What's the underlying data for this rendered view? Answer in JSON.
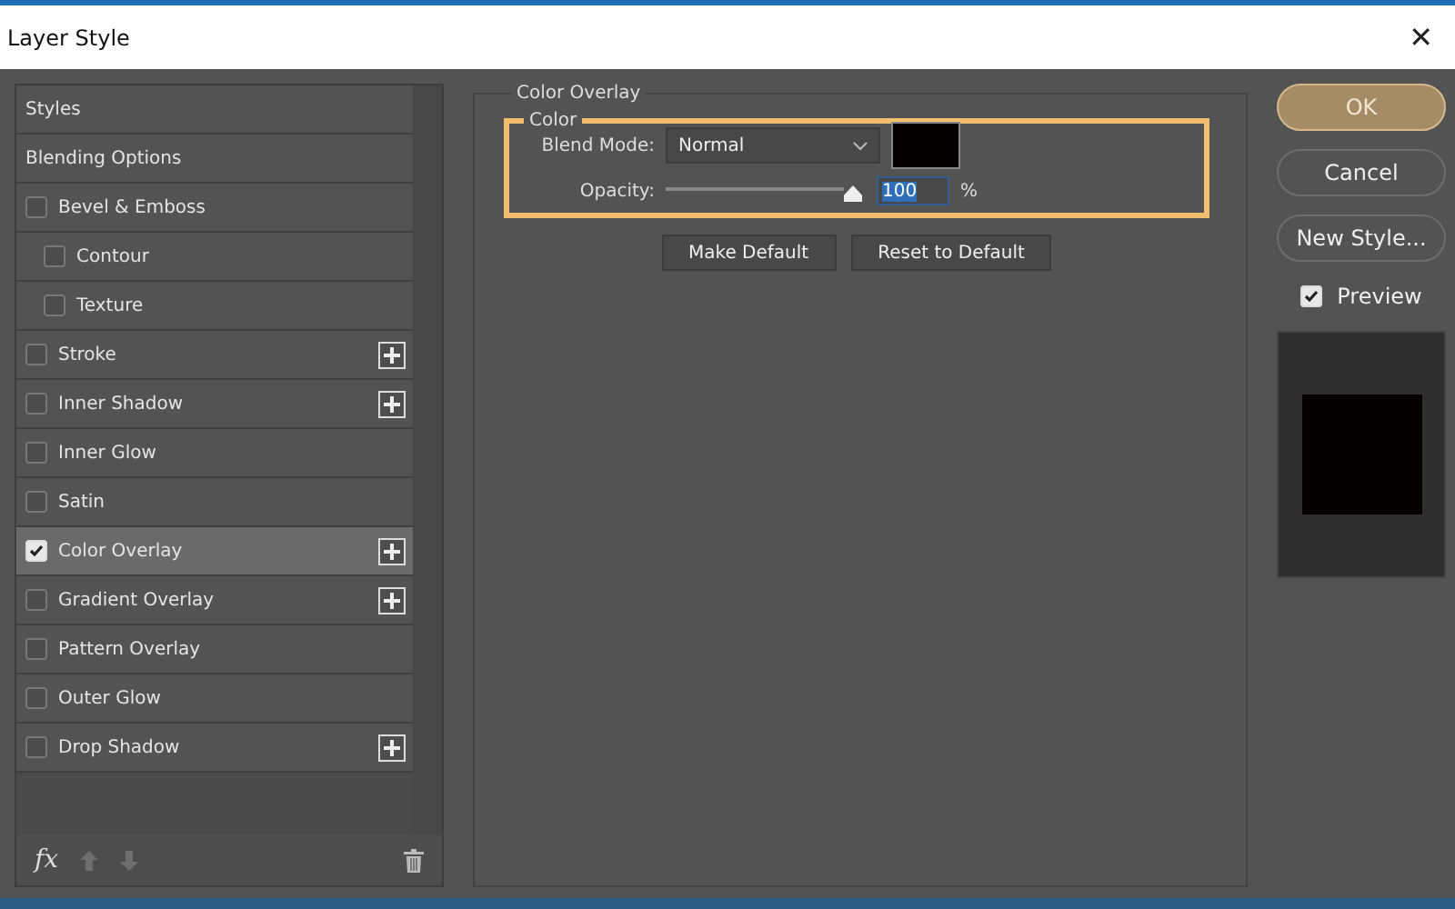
{
  "window": {
    "title": "Layer Style",
    "close": "✕"
  },
  "styles_list": [
    {
      "label": "Styles",
      "kind": "header",
      "selected": false
    },
    {
      "label": "Blending Options",
      "kind": "header",
      "selected": false
    },
    {
      "label": "Bevel & Emboss",
      "kind": "effect",
      "checked": false,
      "selected": false,
      "add": false,
      "children": [
        {
          "label": "Contour",
          "kind": "effect",
          "checked": false,
          "selected": false,
          "add": false
        },
        {
          "label": "Texture",
          "kind": "effect",
          "checked": false,
          "selected": false,
          "add": false
        }
      ]
    },
    {
      "label": "Stroke",
      "kind": "effect",
      "checked": false,
      "selected": false,
      "add": true
    },
    {
      "label": "Inner Shadow",
      "kind": "effect",
      "checked": false,
      "selected": false,
      "add": true
    },
    {
      "label": "Inner Glow",
      "kind": "effect",
      "checked": false,
      "selected": false,
      "add": false
    },
    {
      "label": "Satin",
      "kind": "effect",
      "checked": false,
      "selected": false,
      "add": false
    },
    {
      "label": "Color Overlay",
      "kind": "effect",
      "checked": true,
      "selected": true,
      "add": true
    },
    {
      "label": "Gradient Overlay",
      "kind": "effect",
      "checked": false,
      "selected": false,
      "add": true
    },
    {
      "label": "Pattern Overlay",
      "kind": "effect",
      "checked": false,
      "selected": false,
      "add": false
    },
    {
      "label": "Outer Glow",
      "kind": "effect",
      "checked": false,
      "selected": false,
      "add": false
    },
    {
      "label": "Drop Shadow",
      "kind": "effect",
      "checked": false,
      "selected": false,
      "add": true
    }
  ],
  "list_footer": {
    "fx": "fx"
  },
  "panel": {
    "title": "Color Overlay",
    "group_title": "Color",
    "highlighted": true,
    "blend_mode": {
      "label": "Blend Mode:",
      "value": "Normal",
      "color": "#050000"
    },
    "opacity": {
      "label": "Opacity:",
      "level": 1,
      "value": "100",
      "unit": "%"
    },
    "buttons": [
      "Make Default",
      "Reset to Default"
    ]
  },
  "actions": [
    {
      "label": "OK",
      "primary": true
    },
    {
      "label": "Cancel",
      "primary": false
    },
    {
      "label": "New Style...",
      "primary": false
    }
  ],
  "preview": {
    "label": "Preview",
    "checked": true,
    "color": "#050000"
  }
}
